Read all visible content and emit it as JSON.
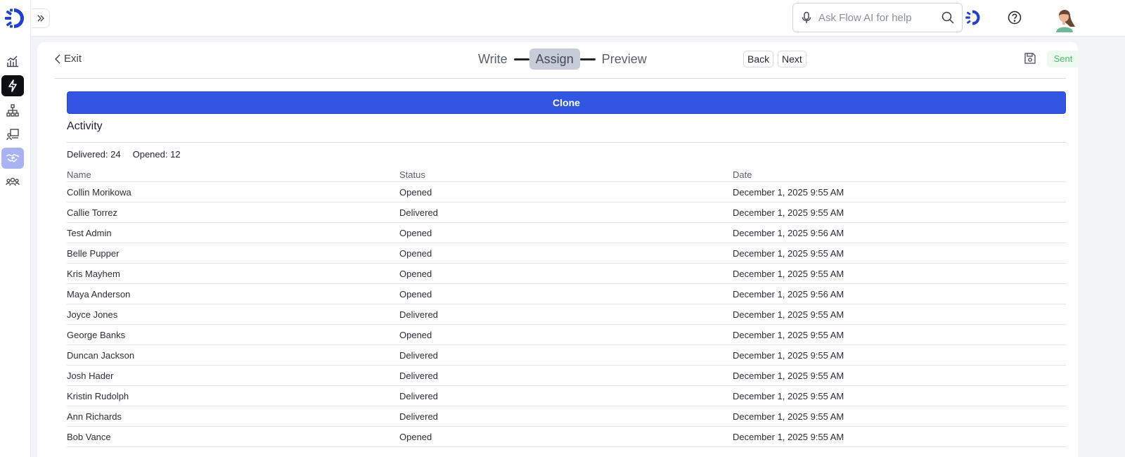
{
  "search": {
    "placeholder": "Ask Flow AI for help"
  },
  "header": {
    "exit_label": "Exit",
    "steps": [
      "Write",
      "Assign",
      "Preview"
    ],
    "active_step": "Assign",
    "back_label": "Back",
    "next_label": "Next",
    "status_badge": "Sent"
  },
  "clone_label": "Clone",
  "activity": {
    "title": "Activity",
    "delivered_label": "Delivered: 24",
    "opened_label": "Opened: 12"
  },
  "table": {
    "columns": [
      "Name",
      "Status",
      "Date"
    ],
    "rows": [
      [
        "Collin Morikowa",
        "Opened",
        "December 1, 2025 9:55 AM"
      ],
      [
        "Callie Torrez",
        "Delivered",
        "December 1, 2025 9:55 AM"
      ],
      [
        "Test Admin",
        "Opened",
        "December 1, 2025 9:56 AM"
      ],
      [
        "Belle Pupper",
        "Opened",
        "December 1, 2025 9:55 AM"
      ],
      [
        "Kris Mayhem",
        "Opened",
        "December 1, 2025 9:55 AM"
      ],
      [
        "Maya Anderson",
        "Opened",
        "December 1, 2025 9:56 AM"
      ],
      [
        "Joyce Jones",
        "Delivered",
        "December 1, 2025 9:55 AM"
      ],
      [
        "George Banks",
        "Opened",
        "December 1, 2025 9:55 AM"
      ],
      [
        "Duncan Jackson",
        "Delivered",
        "December 1, 2025 9:55 AM"
      ],
      [
        "Josh Hader",
        "Delivered",
        "December 1, 2025 9:55 AM"
      ],
      [
        "Kristin Rudolph",
        "Delivered",
        "December 1, 2025 9:55 AM"
      ],
      [
        "Ann Richards",
        "Delivered",
        "December 1, 2025 9:55 AM"
      ],
      [
        "Bob Vance",
        "Opened",
        "December 1, 2025 9:55 AM"
      ]
    ]
  },
  "icons": {
    "rail": [
      "analytics-icon",
      "lightning-icon",
      "org-chart-icon",
      "presentation-icon",
      "handshake-icon",
      "team-icon"
    ],
    "top": [
      "microphone-icon",
      "search-icon",
      "flow-ai-icon",
      "help-icon",
      "avatar"
    ]
  },
  "colors": {
    "primary": "#3255e3",
    "sent_text": "#4bbb6e",
    "sent_bg": "#eef9f1",
    "brand": "#1f3fd8"
  }
}
